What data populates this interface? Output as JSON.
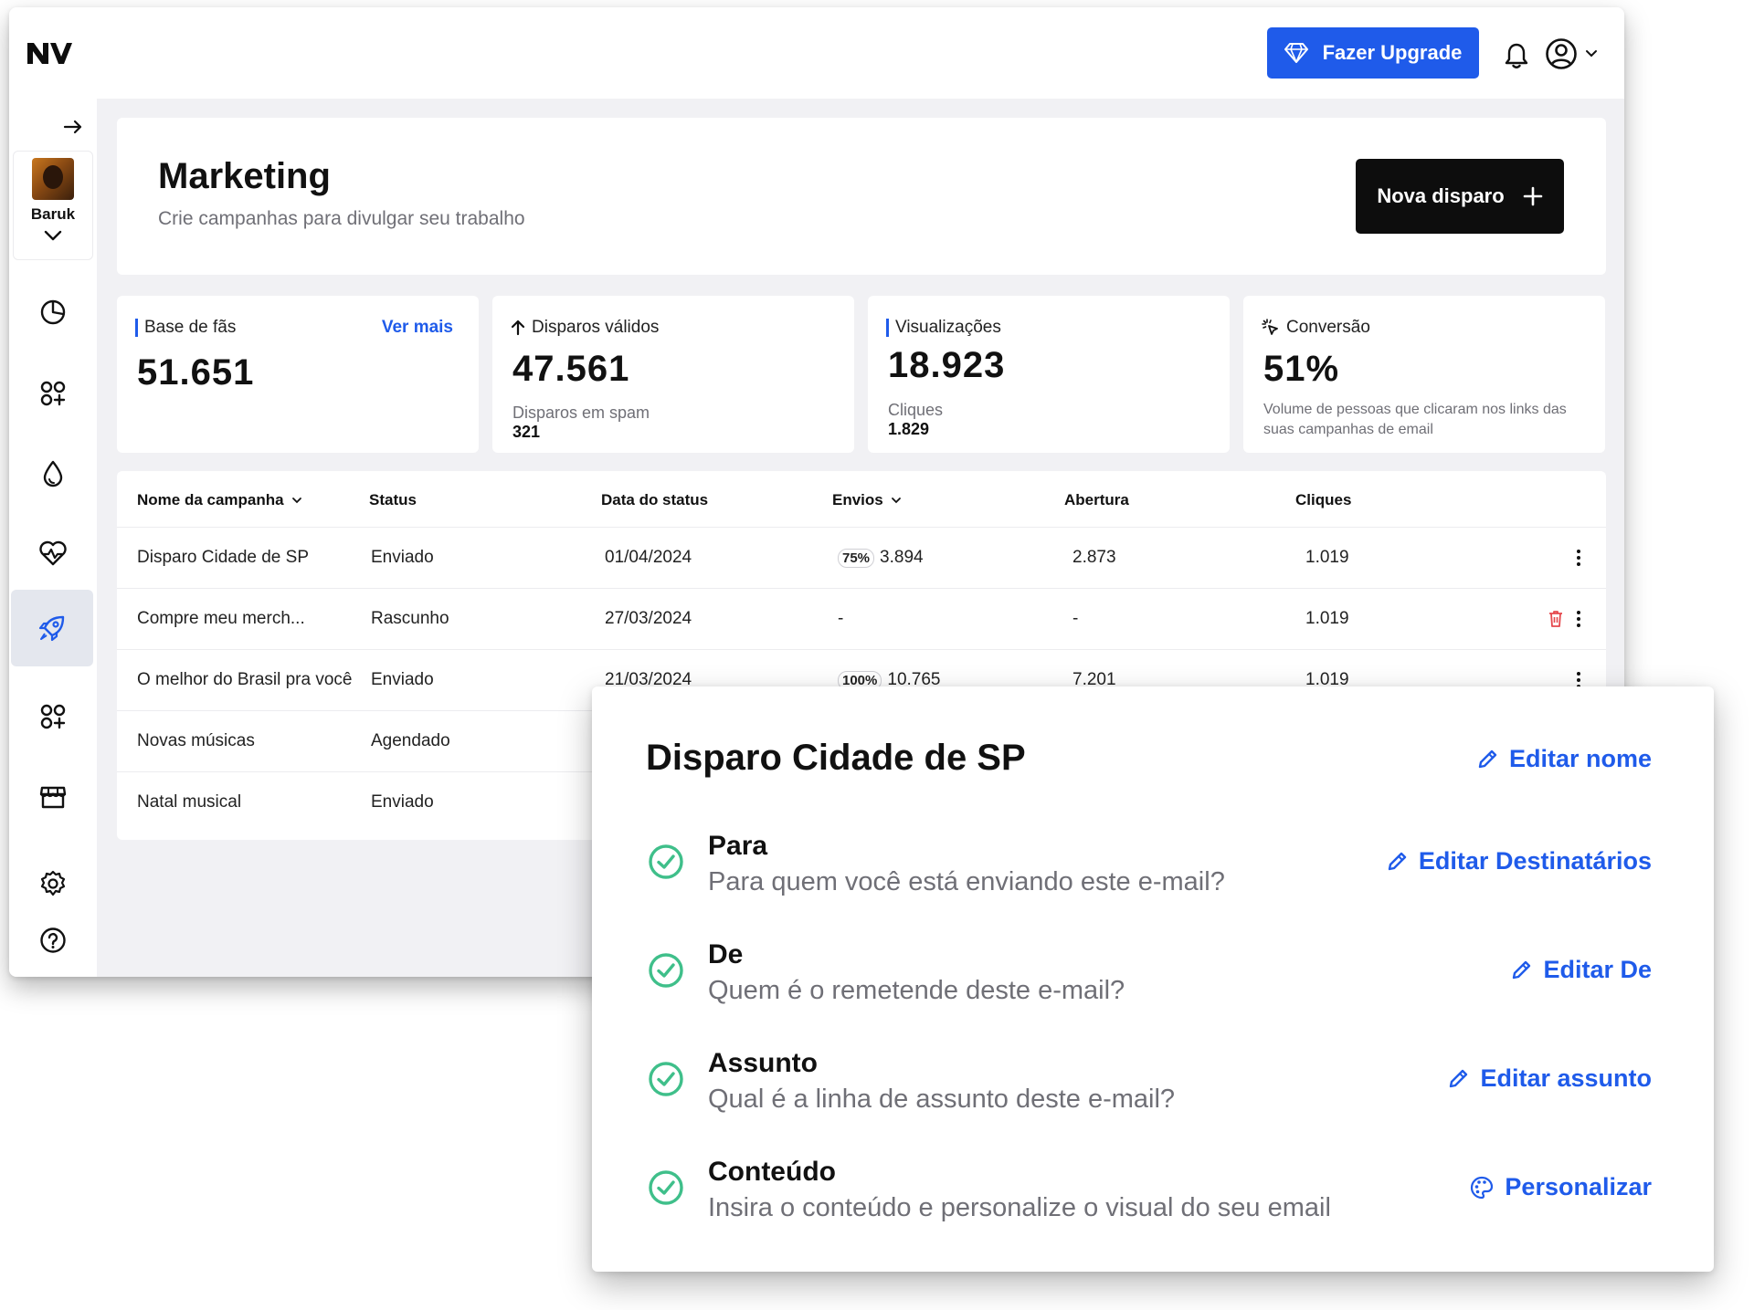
{
  "topbar": {
    "logo": "NV",
    "upgrade_label": "Fazer Upgrade"
  },
  "sidebar": {
    "profile_name": "Baruk",
    "items": [
      {
        "icon": "pie-chart-icon"
      },
      {
        "icon": "apps-icon"
      },
      {
        "icon": "drop-icon"
      },
      {
        "icon": "heart-pulse-icon"
      },
      {
        "icon": "rocket-icon",
        "active": true
      },
      {
        "icon": "apps-icon"
      },
      {
        "icon": "store-icon"
      },
      {
        "icon": "settings-icon"
      },
      {
        "icon": "help-icon"
      }
    ]
  },
  "header": {
    "title": "Marketing",
    "subtitle": "Crie campanhas para divulgar seu trabalho",
    "new_button": "Nova disparo"
  },
  "stats": {
    "fans": {
      "label": "Base de fãs",
      "link": "Ver mais",
      "value": "51.651"
    },
    "valid": {
      "label": "Disparos válidos",
      "value": "47.561",
      "sub_label": "Disparos em spam",
      "sub_value": "321"
    },
    "views": {
      "label": "Visualizações",
      "value": "18.923",
      "sub_label": "Cliques",
      "sub_value": "1.829"
    },
    "conversion": {
      "label": "Conversão",
      "value": "51%",
      "description": "Volume de pessoas que clicaram nos links das suas campanhas de email"
    }
  },
  "table": {
    "columns": [
      "Nome da campanha",
      "Status",
      "Data do status",
      "Envios",
      "Abertura",
      "Cliques"
    ],
    "rows": [
      {
        "name": "Disparo Cidade de SP",
        "status": "Enviado",
        "date": "01/04/2024",
        "badge": "75%",
        "sends": "3.894",
        "opens": "2.873",
        "clicks": "1.019"
      },
      {
        "name": "Compre meu merch...",
        "status": "Rascunho",
        "date": "27/03/2024",
        "badge": "",
        "sends": "-",
        "opens": "-",
        "clicks": "1.019"
      },
      {
        "name": "O melhor do Brasil pra você",
        "status": "Enviado",
        "date": "21/03/2024",
        "badge": "100%",
        "sends": "10.765",
        "opens": "7.201",
        "clicks": "1.019"
      },
      {
        "name": "Novas músicas",
        "status": "Agendado"
      },
      {
        "name": "Natal musical",
        "status": "Enviado"
      }
    ]
  },
  "popover": {
    "title": "Disparo Cidade de SP",
    "edit_name": "Editar nome",
    "steps": [
      {
        "title": "Para",
        "description": "Para quem você está enviando este e-mail?",
        "action": "Editar Destinatários"
      },
      {
        "title": "De",
        "description": "Quem é o remetende deste e-mail?",
        "action": "Editar De"
      },
      {
        "title": "Assunto",
        "description": "Qual é a linha de assunto deste e-mail?",
        "action": "Editar assunto"
      },
      {
        "title": "Conteúdo",
        "description": "Insira o conteúdo e personalize o visual do seu email",
        "action": "Personalizar"
      }
    ]
  },
  "colors": {
    "accent": "#1f5bea",
    "success": "#3fbf8a",
    "danger": "#e5484d",
    "dark": "#0d0d0d"
  }
}
